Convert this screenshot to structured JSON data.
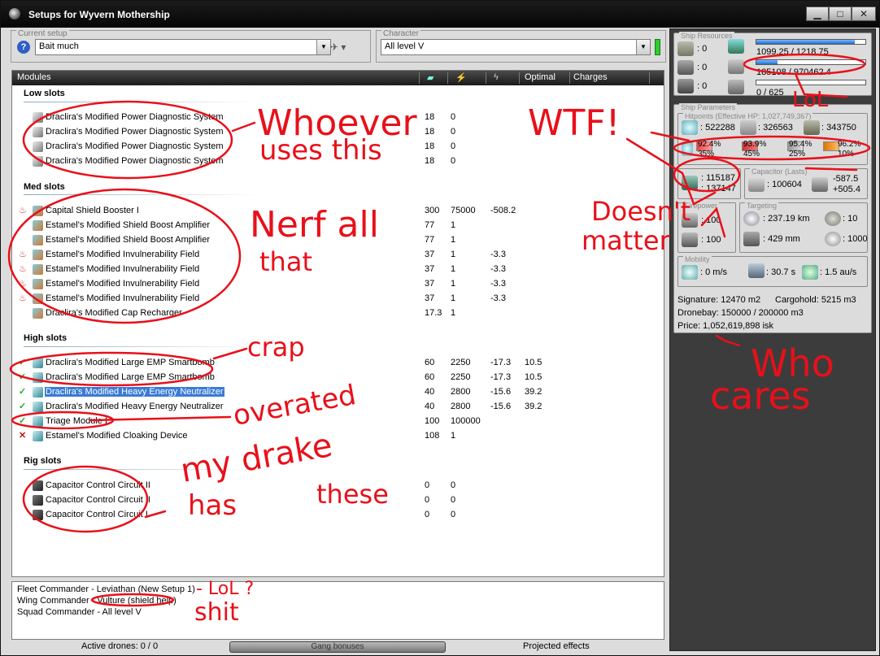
{
  "window": {
    "title": "Setups for Wyvern Mothership",
    "min": "▁",
    "max": "□",
    "close": "✕"
  },
  "setup": {
    "legend": "Current setup",
    "value": "Bait much",
    "help": "?"
  },
  "character": {
    "legend": "Character",
    "value": "All level V"
  },
  "columns": {
    "modules": "Modules",
    "optimal": "Optimal",
    "charges": "Charges"
  },
  "sections": {
    "low": "Low slots",
    "med": "Med slots",
    "high": "High slots",
    "rig": "Rig slots"
  },
  "low_slots": [
    {
      "name": "Draclira's Modified Power Diagnostic System",
      "c1": "18",
      "c2": "0",
      "c3": "",
      "c4": ""
    },
    {
      "name": "Draclira's Modified Power Diagnostic System",
      "c1": "18",
      "c2": "0",
      "c3": "",
      "c4": ""
    },
    {
      "name": "Draclira's Modified Power Diagnostic System",
      "c1": "18",
      "c2": "0",
      "c3": "",
      "c4": ""
    },
    {
      "name": "Draclira's Modified Power Diagnostic System",
      "c1": "18",
      "c2": "0",
      "c3": "",
      "c4": ""
    }
  ],
  "med_slots": [
    {
      "name": "Capital Shield Booster I",
      "c1": "300",
      "c2": "75000",
      "c3": "-508.2",
      "c4": "",
      "status": "heat"
    },
    {
      "name": "Estamel's Modified Shield Boost Amplifier",
      "c1": "77",
      "c2": "1",
      "c3": "",
      "c4": "",
      "status": ""
    },
    {
      "name": "Estamel's Modified Shield Boost Amplifier",
      "c1": "77",
      "c2": "1",
      "c3": "",
      "c4": "",
      "status": ""
    },
    {
      "name": "Estamel's Modified Invulnerability Field",
      "c1": "37",
      "c2": "1",
      "c3": "-3.3",
      "c4": "",
      "status": "heat"
    },
    {
      "name": "Estamel's Modified Invulnerability Field",
      "c1": "37",
      "c2": "1",
      "c3": "-3.3",
      "c4": "",
      "status": "heat"
    },
    {
      "name": "Estamel's Modified Invulnerability Field",
      "c1": "37",
      "c2": "1",
      "c3": "-3.3",
      "c4": "",
      "status": "heat"
    },
    {
      "name": "Estamel's Modified Invulnerability Field",
      "c1": "37",
      "c2": "1",
      "c3": "-3.3",
      "c4": "",
      "status": "heat"
    },
    {
      "name": "Draclira's Modified Cap Recharger",
      "c1": "17.3",
      "c2": "1",
      "c3": "",
      "c4": "",
      "status": ""
    }
  ],
  "high_slots": [
    {
      "name": "Draclira's Modified Large EMP Smartbomb",
      "c1": "60",
      "c2": "2250",
      "c3": "-17.3",
      "c4": "10.5",
      "status": "ok"
    },
    {
      "name": "Draclira's Modified Large EMP Smartbomb",
      "c1": "60",
      "c2": "2250",
      "c3": "-17.3",
      "c4": "10.5",
      "status": "ok"
    },
    {
      "name": "Draclira's Modified Heavy Energy Neutralizer",
      "c1": "40",
      "c2": "2800",
      "c3": "-15.6",
      "c4": "39.2",
      "status": "ok"
    },
    {
      "name": "Draclira's Modified Heavy Energy Neutralizer",
      "c1": "40",
      "c2": "2800",
      "c3": "-15.6",
      "c4": "39.2",
      "status": "ok"
    },
    {
      "name": "Triage Module I",
      "c1": "100",
      "c2": "100000",
      "c3": "",
      "c4": "",
      "status": "ok"
    },
    {
      "name": "Estamel's Modified Cloaking Device",
      "c1": "108",
      "c2": "1",
      "c3": "",
      "c4": "",
      "status": "x"
    }
  ],
  "rig_slots": [
    {
      "name": "Capacitor Control Circuit II",
      "c1": "0",
      "c2": "0"
    },
    {
      "name": "Capacitor Control Circuit II",
      "c1": "0",
      "c2": "0"
    },
    {
      "name": "Capacitor Control Circuit I",
      "c1": "0",
      "c2": "0"
    }
  ],
  "fleet": {
    "fleet": "Fleet Commander - Leviathan (New Setup 1)",
    "wing": "Wing Commander - Vulture (shield help)",
    "squad": "Squad Commander - All level V"
  },
  "status": {
    "drones": "Active drones: 0 / 0",
    "gang": "Gang bonuses",
    "projected": "Projected effects"
  },
  "resources": {
    "legend": "Ship Resources",
    "turrets": ": 0",
    "launchers": ": 0",
    "drones": ": 0",
    "cpu": "1099.25 / 1218.75",
    "cpu_fill": 0.902,
    "power": "185108 / 970462.4",
    "power_fill": 0.191,
    "calibration": "0 / 625",
    "calibration_fill": 0
  },
  "params": {
    "legend": "Ship Parameters",
    "hp_legend": "Hitpoints (Effective HP: 1,027,749,367)",
    "shield": ": 522288",
    "armor": ": 326563",
    "structure": ": 343750",
    "res1": "92.4%",
    "res2": "93.9%",
    "res3": "95.4%",
    "res4": "96.2%",
    "res1b": "35%",
    "res2b": "45%",
    "res3b": "25%",
    "res4b": "10%",
    "tank1": ": 115187",
    "tank2": ": 137147",
    "cap_legend": "Capacitor (Lasts)",
    "cap": ": 100604",
    "cap_use": "-587.5",
    "cap_rec": "+505.4",
    "fire_legend": "Firepower",
    "fire1": ": 100",
    "fire2": ": 100",
    "target_legend": "Targeting",
    "range": ": 237.19 km",
    "targets": ": 10",
    "res": ": 429 mm",
    "sensor": ": 1000",
    "mob_legend": "Mobility",
    "speed": ": 0 m/s",
    "align": ": 30.7 s",
    "warp": ": 1.5 au/s",
    "signature": "Signature: 12470 m2",
    "cargohold": "Cargohold: 5215 m3",
    "dronebay": "Dronebay: 150000 / 200000 m3",
    "price": "Price: 1,052,619,898 isk"
  },
  "annotations": {
    "a1": "Whoever",
    "a2": "uses this",
    "a3": "WTF!",
    "a4": "LoL",
    "a5": "Doesn't",
    "a6": "matter",
    "a7": "Nerf all",
    "a8": "that",
    "a9": "crap",
    "a10": "overated",
    "a11": "my drake",
    "a12": "has",
    "a13": "these",
    "a14": "Who",
    "a15": "cares",
    "a16": "- LoL ?",
    "a17": "shit"
  },
  "colors": {
    "accent": "#3a7bd5",
    "annotation": "#e8101a",
    "panel_dark": "#3c3c3c"
  }
}
